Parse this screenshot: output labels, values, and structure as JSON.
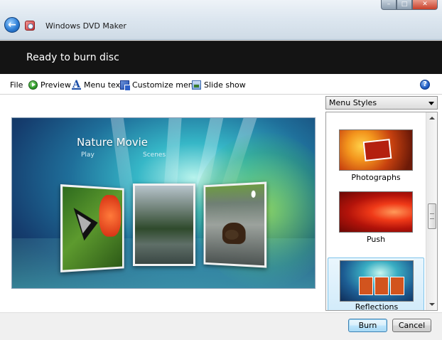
{
  "window": {
    "title": "Windows DVD Maker",
    "buttons": {
      "minimize": "–",
      "maximize": "□",
      "close": "✕"
    }
  },
  "status": {
    "text": "Ready to burn disc"
  },
  "toolbar": {
    "file": "File",
    "preview": "Preview",
    "menu_text": "Menu text",
    "customize_menu": "Customize menu",
    "slide_show": "Slide show",
    "help": "?"
  },
  "preview": {
    "title": "Nature Movie",
    "play": "Play",
    "scenes": "Scenes"
  },
  "menu_styles": {
    "dropdown_label": "Menu Styles",
    "items": [
      {
        "label": "Photographs",
        "selected": false
      },
      {
        "label": "Push",
        "selected": false
      },
      {
        "label": "Reflections",
        "selected": true
      }
    ]
  },
  "footer": {
    "burn": "Burn",
    "cancel": "Cancel"
  },
  "colors": {
    "accent": "#2f7fd6",
    "status_band": "#141414",
    "selection": "#d2ebfa"
  }
}
